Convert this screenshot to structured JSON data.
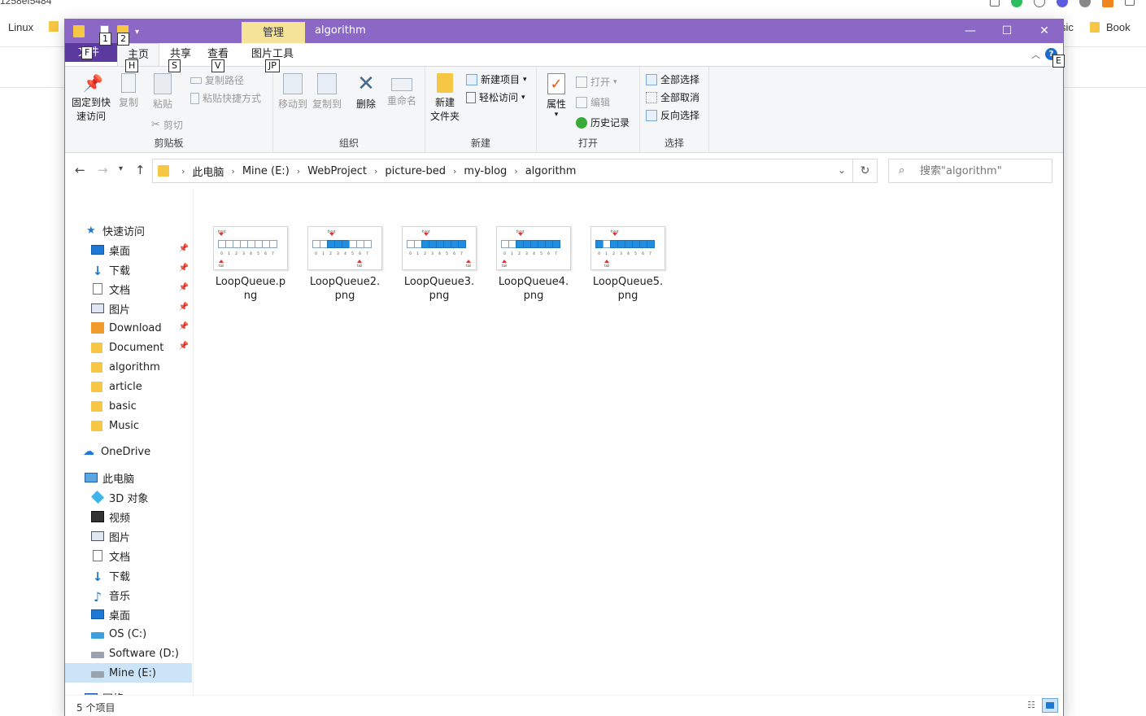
{
  "browser": {
    "url_fragment": "1258ef5484",
    "bookmarks": {
      "linux": "Linux",
      "partial": "sic",
      "book": "Book"
    }
  },
  "window": {
    "title": "algorithm",
    "manage_tab": "管理",
    "minimize": "—",
    "maximize": "☐",
    "close": "✕",
    "qat_keytips": [
      "1",
      "2"
    ]
  },
  "ribbon_tabs": [
    {
      "label": "文件",
      "keytip": "F"
    },
    {
      "label": "主页",
      "keytip": "H"
    },
    {
      "label": "共享",
      "keytip": "S"
    },
    {
      "label": "查看",
      "keytip": "V"
    },
    {
      "label": "图片工具",
      "keytip": "JP"
    }
  ],
  "help_keytip": "E",
  "ribbon": {
    "clipboard": {
      "label": "剪贴板",
      "pin": "固定到快\n速访问",
      "copy": "复制",
      "paste": "粘贴",
      "copy_path": "复制路径",
      "paste_shortcut": "粘贴快捷方式",
      "cut": "剪切"
    },
    "organize": {
      "label": "组织",
      "move_to": "移动到",
      "copy_to": "复制到",
      "delete": "删除",
      "rename": "重命名"
    },
    "new": {
      "label": "新建",
      "new_folder": "新建\n文件夹",
      "new_item": "新建项目",
      "easy_access": "轻松访问"
    },
    "open": {
      "label": "打开",
      "properties": "属性",
      "open": "打开",
      "edit": "编辑",
      "history": "历史记录"
    },
    "select": {
      "label": "选择",
      "select_all": "全部选择",
      "select_none": "全部取消",
      "invert": "反向选择"
    }
  },
  "address": {
    "crumbs": [
      "此电脑",
      "Mine (E:)",
      "WebProject",
      "picture-bed",
      "my-blog",
      "algorithm"
    ],
    "search_placeholder": "搜索\"algorithm\""
  },
  "nav": {
    "quick_access": "快速访问",
    "quick_items": [
      "桌面",
      "下载",
      "文档",
      "图片",
      "Download",
      "Document",
      "algorithm",
      "article",
      "basic",
      "Music"
    ],
    "onedrive": "OneDrive",
    "this_pc": "此电脑",
    "pc_items": [
      "3D 对象",
      "视频",
      "图片",
      "文档",
      "下载",
      "音乐",
      "桌面",
      "OS (C:)",
      "Software (D:)",
      "Mine (E:)"
    ],
    "network": "网络"
  },
  "files": [
    {
      "name": "LoopQueue.png"
    },
    {
      "name": "LoopQueue2.png"
    },
    {
      "name": "LoopQueue3.png"
    },
    {
      "name": "LoopQueue4.png"
    },
    {
      "name": "LoopQueue5.png"
    }
  ],
  "status": {
    "count": "5 个项目"
  },
  "colors": {
    "titlebar": "#8b67c6",
    "file_tab": "#5b3aa0",
    "manage_tab": "#f5e39a",
    "selection": "#cce4f7",
    "accent": "#1f78d1"
  }
}
